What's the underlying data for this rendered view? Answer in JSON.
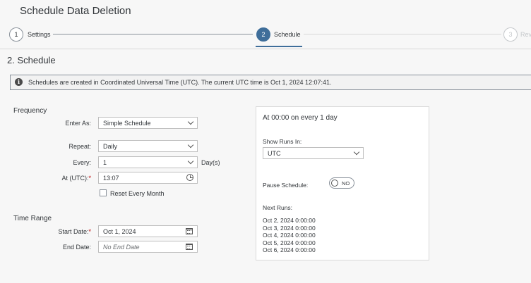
{
  "page": {
    "title": "Schedule Data Deletion"
  },
  "wizard": {
    "steps": [
      {
        "number": "1",
        "label": "Settings"
      },
      {
        "number": "2",
        "label": "Schedule"
      },
      {
        "number": "3",
        "label": "Rev"
      }
    ]
  },
  "section": {
    "title": "2. Schedule"
  },
  "info": {
    "message": "Schedules are created in Coordinated Universal Time (UTC). The current UTC time is Oct 1, 2024 12:07:41."
  },
  "frequency": {
    "title": "Frequency",
    "enter_as": {
      "label": "Enter As:",
      "value": "Simple Schedule"
    },
    "repeat": {
      "label": "Repeat:",
      "value": "Daily"
    },
    "every": {
      "label": "Every:",
      "value": "1",
      "unit": "Day(s)"
    },
    "at_utc": {
      "label": "At (UTC):",
      "required": "*",
      "value": "13:07"
    },
    "reset": {
      "label": "Reset Every Month",
      "checked": false
    }
  },
  "time_range": {
    "title": "Time Range",
    "start_date": {
      "label": "Start Date:",
      "required": "*",
      "value": "Oct 1, 2024"
    },
    "end_date": {
      "label": "End Date:",
      "placeholder": "No End Date"
    }
  },
  "summary": {
    "headline": "At 00:00 on every 1 day",
    "show_runs_label": "Show Runs In:",
    "show_runs_value": "UTC",
    "pause_label": "Pause Schedule:",
    "pause_toggle": "NO",
    "next_runs_label": "Next Runs:",
    "next_runs": [
      "Oct 2, 2024 0:00:00",
      "Oct 3, 2024 0:00:00",
      "Oct 4, 2024 0:00:00",
      "Oct 5, 2024 0:00:00",
      "Oct 6, 2024 0:00:00"
    ]
  },
  "icons": {
    "info": "info-icon",
    "dropdown": "chevron-down-icon",
    "calendar": "calendar-icon",
    "time": "clock-icon"
  }
}
